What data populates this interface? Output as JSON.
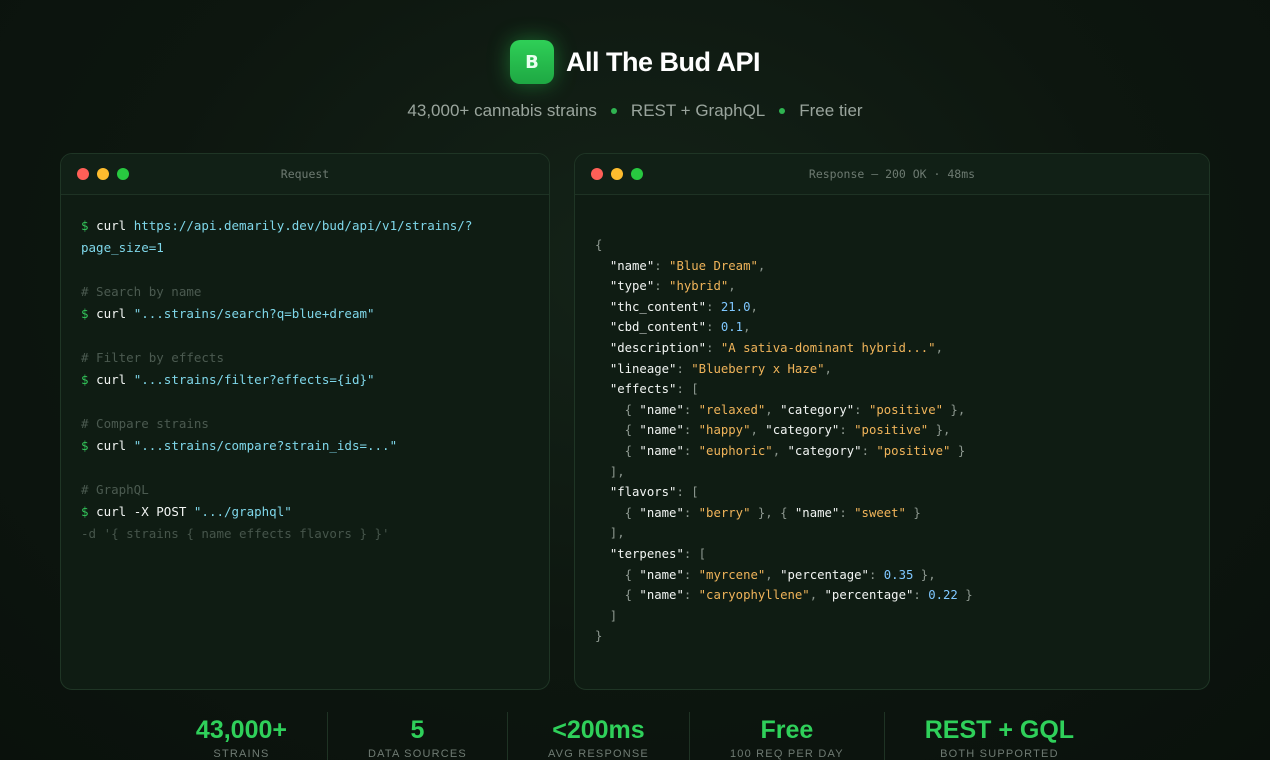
{
  "header": {
    "logo_letter": "B",
    "title": "All The Bud API",
    "subtitle": [
      "43,000+ cannabis strains",
      "REST + GraphQL",
      "Free tier"
    ]
  },
  "request_panel": {
    "title": "Request",
    "lines": [
      [
        {
          "t": "prompt",
          "v": "$ "
        },
        {
          "t": "cmd",
          "v": "curl "
        },
        {
          "t": "url",
          "v": "https://api.demarily.dev/bud/api/v1/strains/?"
        }
      ],
      [
        {
          "t": "url",
          "v": "page_size=1"
        }
      ],
      [],
      [
        {
          "t": "cmt",
          "v": "# Search by name"
        }
      ],
      [
        {
          "t": "prompt",
          "v": "$ "
        },
        {
          "t": "cmd",
          "v": "curl "
        },
        {
          "t": "url",
          "v": "\"...strains/search?q=blue+dream\""
        }
      ],
      [],
      [
        {
          "t": "cmt",
          "v": "# Filter by effects"
        }
      ],
      [
        {
          "t": "prompt",
          "v": "$ "
        },
        {
          "t": "cmd",
          "v": "curl "
        },
        {
          "t": "url",
          "v": "\"...strains/filter?effects={id}\""
        }
      ],
      [],
      [
        {
          "t": "cmt",
          "v": "# Compare strains"
        }
      ],
      [
        {
          "t": "prompt",
          "v": "$ "
        },
        {
          "t": "cmd",
          "v": "curl "
        },
        {
          "t": "url",
          "v": "\"...strains/compare?strain_ids=...\""
        }
      ],
      [],
      [
        {
          "t": "cmt",
          "v": "# GraphQL"
        }
      ],
      [
        {
          "t": "prompt",
          "v": "$ "
        },
        {
          "t": "cmd",
          "v": "curl -X POST "
        },
        {
          "t": "url",
          "v": "\".../graphql\""
        }
      ],
      [
        {
          "t": "dim",
          "v": "-d '{ strains { name effects flavors } }'"
        }
      ]
    ]
  },
  "response_panel": {
    "title": "Response — 200 OK · 48ms",
    "lines": [
      [
        {
          "t": "pun",
          "v": "{"
        }
      ],
      [
        {
          "t": "pun",
          "v": "  "
        },
        {
          "t": "key",
          "v": "\"name\""
        },
        {
          "t": "pun",
          "v": ": "
        },
        {
          "t": "str",
          "v": "\"Blue Dream\""
        },
        {
          "t": "pun",
          "v": ","
        }
      ],
      [
        {
          "t": "pun",
          "v": "  "
        },
        {
          "t": "key",
          "v": "\"type\""
        },
        {
          "t": "pun",
          "v": ": "
        },
        {
          "t": "str",
          "v": "\"hybrid\""
        },
        {
          "t": "pun",
          "v": ","
        }
      ],
      [
        {
          "t": "pun",
          "v": "  "
        },
        {
          "t": "key",
          "v": "\"thc_content\""
        },
        {
          "t": "pun",
          "v": ": "
        },
        {
          "t": "num",
          "v": "21.0"
        },
        {
          "t": "pun",
          "v": ","
        }
      ],
      [
        {
          "t": "pun",
          "v": "  "
        },
        {
          "t": "key",
          "v": "\"cbd_content\""
        },
        {
          "t": "pun",
          "v": ": "
        },
        {
          "t": "num",
          "v": "0.1"
        },
        {
          "t": "pun",
          "v": ","
        }
      ],
      [
        {
          "t": "pun",
          "v": "  "
        },
        {
          "t": "key",
          "v": "\"description\""
        },
        {
          "t": "pun",
          "v": ": "
        },
        {
          "t": "str",
          "v": "\"A sativa-dominant hybrid...\""
        },
        {
          "t": "pun",
          "v": ","
        }
      ],
      [
        {
          "t": "pun",
          "v": "  "
        },
        {
          "t": "key",
          "v": "\"lineage\""
        },
        {
          "t": "pun",
          "v": ": "
        },
        {
          "t": "str",
          "v": "\"Blueberry x Haze\""
        },
        {
          "t": "pun",
          "v": ","
        }
      ],
      [
        {
          "t": "pun",
          "v": "  "
        },
        {
          "t": "key",
          "v": "\"effects\""
        },
        {
          "t": "pun",
          "v": ": ["
        }
      ],
      [
        {
          "t": "pun",
          "v": "    { "
        },
        {
          "t": "key",
          "v": "\"name\""
        },
        {
          "t": "pun",
          "v": ": "
        },
        {
          "t": "str",
          "v": "\"relaxed\""
        },
        {
          "t": "pun",
          "v": ", "
        },
        {
          "t": "key",
          "v": "\"category\""
        },
        {
          "t": "pun",
          "v": ": "
        },
        {
          "t": "str",
          "v": "\"positive\""
        },
        {
          "t": "pun",
          "v": " },"
        }
      ],
      [
        {
          "t": "pun",
          "v": "    { "
        },
        {
          "t": "key",
          "v": "\"name\""
        },
        {
          "t": "pun",
          "v": ": "
        },
        {
          "t": "str",
          "v": "\"happy\""
        },
        {
          "t": "pun",
          "v": ", "
        },
        {
          "t": "key",
          "v": "\"category\""
        },
        {
          "t": "pun",
          "v": ": "
        },
        {
          "t": "str",
          "v": "\"positive\""
        },
        {
          "t": "pun",
          "v": " },"
        }
      ],
      [
        {
          "t": "pun",
          "v": "    { "
        },
        {
          "t": "key",
          "v": "\"name\""
        },
        {
          "t": "pun",
          "v": ": "
        },
        {
          "t": "str",
          "v": "\"euphoric\""
        },
        {
          "t": "pun",
          "v": ", "
        },
        {
          "t": "key",
          "v": "\"category\""
        },
        {
          "t": "pun",
          "v": ": "
        },
        {
          "t": "str",
          "v": "\"positive\""
        },
        {
          "t": "pun",
          "v": " }"
        }
      ],
      [
        {
          "t": "pun",
          "v": "  ],"
        }
      ],
      [
        {
          "t": "pun",
          "v": "  "
        },
        {
          "t": "key",
          "v": "\"flavors\""
        },
        {
          "t": "pun",
          "v": ": ["
        }
      ],
      [
        {
          "t": "pun",
          "v": "    { "
        },
        {
          "t": "key",
          "v": "\"name\""
        },
        {
          "t": "pun",
          "v": ": "
        },
        {
          "t": "str",
          "v": "\"berry\""
        },
        {
          "t": "pun",
          "v": " }, { "
        },
        {
          "t": "key",
          "v": "\"name\""
        },
        {
          "t": "pun",
          "v": ": "
        },
        {
          "t": "str",
          "v": "\"sweet\""
        },
        {
          "t": "pun",
          "v": " }"
        }
      ],
      [
        {
          "t": "pun",
          "v": "  ],"
        }
      ],
      [
        {
          "t": "pun",
          "v": "  "
        },
        {
          "t": "key",
          "v": "\"terpenes\""
        },
        {
          "t": "pun",
          "v": ": ["
        }
      ],
      [
        {
          "t": "pun",
          "v": "    { "
        },
        {
          "t": "key",
          "v": "\"name\""
        },
        {
          "t": "pun",
          "v": ": "
        },
        {
          "t": "str",
          "v": "\"myrcene\""
        },
        {
          "t": "pun",
          "v": ", "
        },
        {
          "t": "key",
          "v": "\"percentage\""
        },
        {
          "t": "pun",
          "v": ": "
        },
        {
          "t": "num",
          "v": "0.35"
        },
        {
          "t": "pun",
          "v": " },"
        }
      ],
      [
        {
          "t": "pun",
          "v": "    { "
        },
        {
          "t": "key",
          "v": "\"name\""
        },
        {
          "t": "pun",
          "v": ": "
        },
        {
          "t": "str",
          "v": "\"caryophyllene\""
        },
        {
          "t": "pun",
          "v": ", "
        },
        {
          "t": "key",
          "v": "\"percentage\""
        },
        {
          "t": "pun",
          "v": ": "
        },
        {
          "t": "num",
          "v": "0.22"
        },
        {
          "t": "pun",
          "v": " }"
        }
      ],
      [
        {
          "t": "pun",
          "v": "  ]"
        }
      ],
      [
        {
          "t": "pun",
          "v": "}"
        }
      ]
    ]
  },
  "stats": [
    {
      "value": "43,000+",
      "label": "STRAINS"
    },
    {
      "value": "5",
      "label": "DATA SOURCES"
    },
    {
      "value": "<200ms",
      "label": "AVG RESPONSE"
    },
    {
      "value": "Free",
      "label": "100 REQ PER DAY"
    },
    {
      "value": "REST + GQL",
      "label": "BOTH SUPPORTED"
    }
  ],
  "colors": {
    "accent": "#2fd05a",
    "background": "#0d160f",
    "string": "#f0b45a",
    "url": "#7fd7ea",
    "number": "#7fc7ff"
  }
}
